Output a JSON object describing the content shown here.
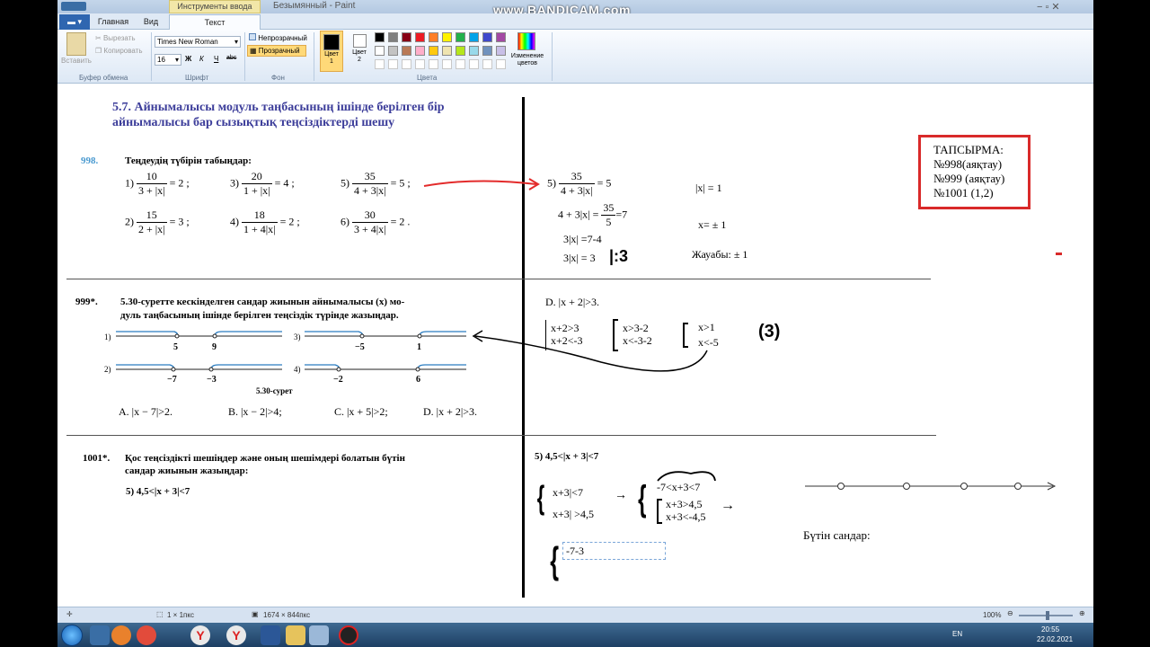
{
  "app": {
    "title": "Безымянный - Paint",
    "context_tab": "Инструменты ввода текста",
    "watermark": "www.BANDICAM.com"
  },
  "tabs": [
    "Главная",
    "Вид",
    "Текст"
  ],
  "ribbon": {
    "clipboard": {
      "paste": "Вставить",
      "cut": "Вырезать",
      "copy": "Копировать",
      "group": "Буфер обмена"
    },
    "font": {
      "name": "Times New Roman",
      "size": "16",
      "bold": "Ж",
      "italic": "К",
      "underline": "Ч",
      "strike": "abc",
      "group": "Шрифт"
    },
    "background": {
      "opaque": "Непрозрачный",
      "transparent": "Прозрачный",
      "group": "Фон"
    },
    "colors": {
      "color1": "Цвет 1",
      "color2": "Цвет 2",
      "edit": "Изменение цветов",
      "group": "Цвета",
      "palette": [
        "#000000",
        "#7f7f7f",
        "#880015",
        "#ed1c24",
        "#ff7f27",
        "#fff200",
        "#22b14c",
        "#00a2e8",
        "#3f48cc",
        "#a349a4",
        "#ffffff",
        "#c3c3c3",
        "#b97a57",
        "#ffaec9",
        "#ffc90e",
        "#efe4b0",
        "#b5e61d",
        "#99d9ea",
        "#7092be",
        "#c8bfe7"
      ]
    }
  },
  "task": {
    "title": "ТАПСЫРМА:",
    "items": [
      "№998(аяқтау)",
      "№999 (аяқтау)",
      "№1001 (1,2)"
    ]
  },
  "section": {
    "title": "5.7. Айнымалысы модуль таңбасының ішінде берілген бір айнымалысы бар сызықтық теңсіздіктерді шешу"
  },
  "p998": {
    "num": "998.",
    "text": "Теңдеудің түбірін табыңдар:",
    "items": [
      {
        "l": "1)",
        "n": "10",
        "d": "3 + |x|",
        "r": "= 2 ;"
      },
      {
        "l": "3)",
        "n": "20",
        "d": "1 + |x|",
        "r": "= 4 ;"
      },
      {
        "l": "5)",
        "n": "35",
        "d": "4 + 3|x|",
        "r": "= 5 ;"
      },
      {
        "l": "2)",
        "n": "15",
        "d": "2 + |x|",
        "r": "= 3 ;"
      },
      {
        "l": "4)",
        "n": "18",
        "d": "1 + 4|x|",
        "r": "= 2 ;"
      },
      {
        "l": "6)",
        "n": "30",
        "d": "3 + 4|x|",
        "r": "= 2 ."
      }
    ]
  },
  "sol998": {
    "l": "5)",
    "n": "35",
    "d": "4 + 3|x|",
    "r": "= 5",
    "s1": "4 + 3|x| =",
    "s1n": "35",
    "s1d": "5",
    "s1r": "=7",
    "s2": "3|x| =7-4",
    "s3": "3|x| = 3",
    "s3b": "|:3",
    "a1": "|x| = 1",
    "a2": "x= ± 1",
    "ans": "Жауабы: ± 1"
  },
  "p999": {
    "num": "999*.",
    "text1": "5.30-суретте кескінделген сандар жиынын айнымалысы (x) мо-",
    "text2": "дуль таңбасының ішінде берілген теңсіздік түрінде жазыңдар.",
    "caption": "5.30-сурет",
    "opts": [
      "A. |x − 7|>2.",
      "B. |x − 2|>4;",
      "C. |x + 5|>2;",
      "D. |x + 2|>3."
    ],
    "lines": [
      {
        "l": "1)",
        "t": [
          "5",
          "9"
        ]
      },
      {
        "l": "3)",
        "t": [
          "−5",
          "1"
        ]
      },
      {
        "l": "2)",
        "t": [
          "−7",
          "−3"
        ]
      },
      {
        "l": "4)",
        "t": [
          "−2",
          "6"
        ]
      }
    ]
  },
  "sol999": {
    "head": "D. |x + 2|>3.",
    "a": [
      "x+2>3",
      "x+2<-3"
    ],
    "b": [
      "x>3-2",
      "x<-3-2"
    ],
    "c": [
      "x>1",
      "x<-5"
    ],
    "mark": "(3)"
  },
  "p1001": {
    "num": "1001*.",
    "text1": "Қос теңсіздікті шешіңдер және оның шешімдері болатын бүтін",
    "text2": "сандар жиынын жазыңдар:",
    "item": "5)  4,5<|x + 3|<7"
  },
  "sol1001": {
    "head": "5)  4,5<|x + 3|<7",
    "a": [
      "x+3|<7",
      "x+3| >4,5"
    ],
    "b": "-7<x+3<7",
    "c": [
      "x+3>4,5",
      "x+3<-4,5"
    ],
    "edit": "-7-3",
    "integers": "Бүтін сандар:"
  },
  "status": {
    "size1": "1 × 1пкс",
    "size2": "1674 × 844пкс",
    "zoom": "100%"
  },
  "taskbar": {
    "lang": "EN",
    "time": "20:55",
    "date": "22.02.2021"
  }
}
